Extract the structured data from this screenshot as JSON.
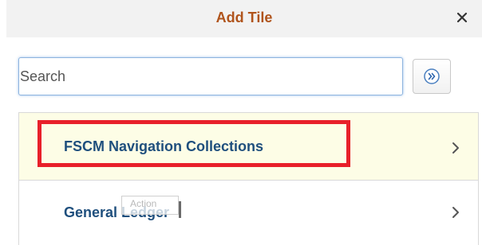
{
  "dialog": {
    "title": "Add Tile",
    "close_icon": "close-icon",
    "close_glyph": "×"
  },
  "search": {
    "placeholder": "Search",
    "value": "",
    "button_icon": "double-chevron-right-icon"
  },
  "list": {
    "items": [
      {
        "label": "FSCM Navigation Collections",
        "icon": "chevron-right-icon",
        "highlighted": true
      },
      {
        "label": "General Ledger",
        "icon": "chevron-right-icon",
        "highlighted": false
      }
    ]
  },
  "tooltip": {
    "text": "Action"
  },
  "colors": {
    "title": "#b0541c",
    "item_label": "#1f4f7d",
    "highlight_box": "#e8202a",
    "selected_row_bg": "#fdfde6",
    "header_bg": "#f2f2f2"
  }
}
